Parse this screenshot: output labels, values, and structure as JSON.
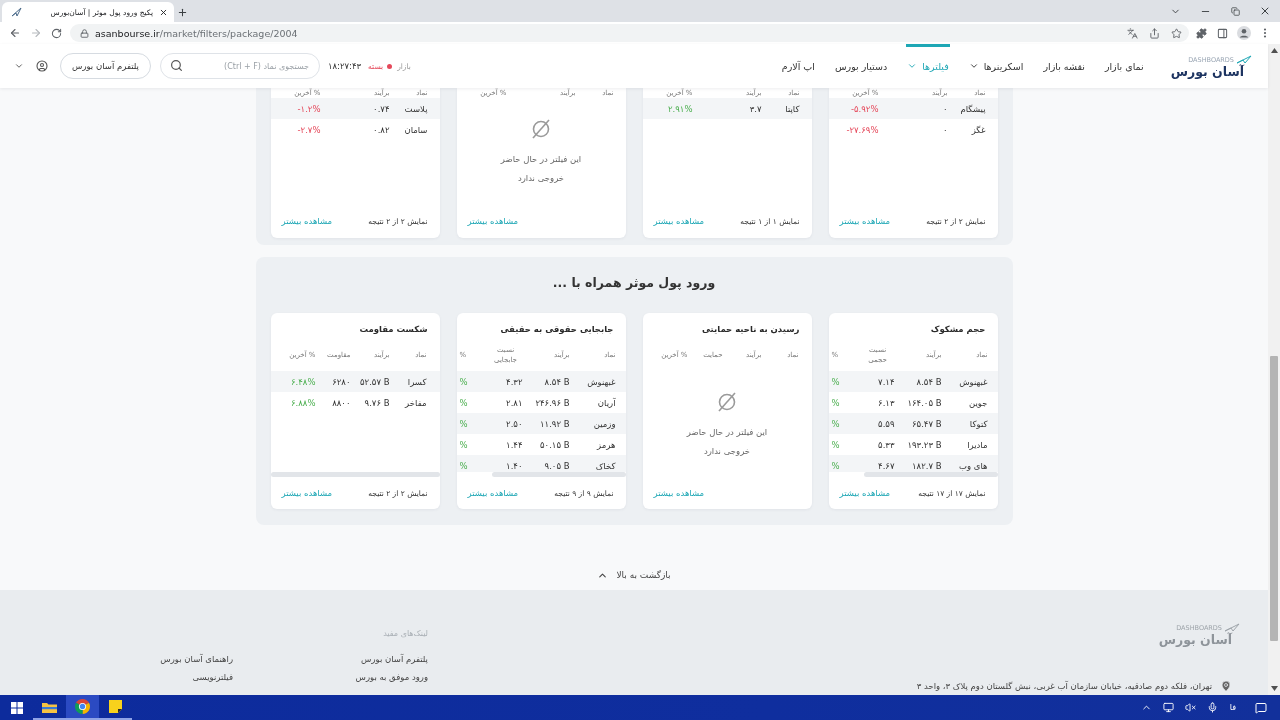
{
  "browser": {
    "tab_title": "پکیج ورود پول موثر | آسان‌بورس",
    "url_host": "asanbourse.ir",
    "url_path": "/market/filters/package/2004"
  },
  "header": {
    "logo": {
      "wordmark": "آسان بورس",
      "tagline": "DASHBOARDS"
    },
    "nav": [
      {
        "label": "نمای بازار",
        "selected": false,
        "has_menu": false
      },
      {
        "label": "نقشه بازار",
        "selected": false,
        "has_menu": false
      },
      {
        "label": "اسکرینرها",
        "selected": false,
        "has_menu": true
      },
      {
        "label": "فیلترها",
        "selected": true,
        "has_menu": true
      },
      {
        "label": "دستیار بورس",
        "selected": false,
        "has_menu": false
      },
      {
        "label": "اپ آلارم",
        "selected": false,
        "has_menu": false
      }
    ],
    "market": {
      "label": "بازار",
      "status": "بسته",
      "open": false,
      "time": "۱۸:۲۷:۴۳"
    },
    "search": {
      "placeholder": "جستجوی نماد (Ctrl + F)"
    },
    "platform_button": "پلتفرم آسان بورس"
  },
  "top_cards": [
    {
      "columns": [
        "نماد",
        "برآیند",
        "% آخرین"
      ],
      "rows": [
        {
          "cells": [
            "پیشگام",
            "۰"
          ],
          "change": "-۵.۹۲%",
          "positive": false
        },
        {
          "cells": [
            "غگز",
            "۰"
          ],
          "change": "-۲۷.۶۹%",
          "positive": false
        }
      ],
      "count": "نمایش ۲ از ۲ نتیجه",
      "more": "مشاهده بیشتر"
    },
    {
      "columns": [
        "نماد",
        "برآیند",
        "% آخرین"
      ],
      "rows": [
        {
          "cells": [
            "کاپتا",
            "۳.۷"
          ],
          "change": "۲.۹۱%",
          "positive": true
        }
      ],
      "count": "نمایش ۱ از ۱ نتیجه",
      "more": "مشاهده بیشتر"
    },
    {
      "columns": [
        "نماد",
        "برآیند",
        "% آخرین"
      ],
      "empty": [
        "این فیلتر در حال حاضر",
        "خروجی ندارد"
      ],
      "more": "مشاهده بیشتر"
    },
    {
      "columns": [
        "نماد",
        "برآیند",
        "% آخرین"
      ],
      "rows": [
        {
          "cells": [
            "پلاست",
            "۰.۷۴"
          ],
          "change": "-۱.۲%",
          "positive": false
        },
        {
          "cells": [
            "سامان",
            "۰.۸۲"
          ],
          "change": "-۲.۷%",
          "positive": false
        }
      ],
      "count": "نمایش ۲ از ۲ نتیجه",
      "more": "مشاهده بیشتر"
    }
  ],
  "section": {
    "title": "ورود پول موثر همراه با ...",
    "cards": [
      {
        "title": "حجم مشکوک",
        "columns": [
          "نماد",
          "برآیند",
          "نسبت حجمی",
          "%"
        ],
        "last_column_cut": true,
        "horizontal_scrollbar": true,
        "rows": [
          {
            "cells": [
              "غبهنوش",
              "۸.۵۴ B",
              "۷.۱۴"
            ],
            "change": "%",
            "positive": true
          },
          {
            "cells": [
              "جوین",
              "۱۶۴.۰۵ B",
              "۶.۱۳"
            ],
            "change": "%",
            "positive": true
          },
          {
            "cells": [
              "کتوکا",
              "۶۵.۴۷ B",
              "۵.۵۹"
            ],
            "change": "%",
            "positive": true
          },
          {
            "cells": [
              "مادیرا",
              "۱۹۳.۲۳ B",
              "۵.۳۳"
            ],
            "change": "%",
            "positive": true
          },
          {
            "cells": [
              "های وب",
              "۱۸۲.۷ B",
              "۴.۶۷"
            ],
            "change": "%",
            "positive": true
          }
        ],
        "count": "نمایش ۱۷ از ۱۷ نتیجه",
        "more": "مشاهده بیشتر"
      },
      {
        "title": "رسیدن به ناحیه حمایتی",
        "columns": [
          "نماد",
          "برآیند",
          "حمایت",
          "% آخرین"
        ],
        "last_column_cut": false,
        "horizontal_scrollbar": false,
        "empty": [
          "این فیلتر در حال حاضر",
          "خروجی ندارد"
        ],
        "more": "مشاهده بیشتر"
      },
      {
        "title": "جابجایی حقوقی به حقیقی",
        "columns": [
          "نماد",
          "برآیند",
          "نسبت جابجایی",
          "%"
        ],
        "last_column_cut": true,
        "horizontal_scrollbar": true,
        "rows": [
          {
            "cells": [
              "غبهنوش",
              "۸.۵۴ B",
              "۴.۳۲"
            ],
            "change": "%",
            "positive": true
          },
          {
            "cells": [
              "آریان",
              "۲۴۶.۹۶ B",
              "۲.۸۱"
            ],
            "change": "%",
            "positive": true
          },
          {
            "cells": [
              "وزمین",
              "۱۱.۹۲ B",
              "۲.۵۰"
            ],
            "change": "%",
            "positive": true
          },
          {
            "cells": [
              "هرمز",
              "۵۰.۱۵ B",
              "۱.۴۴"
            ],
            "change": "%",
            "positive": true
          },
          {
            "cells": [
              "کخاک",
              "۹.۰۵ B",
              "۱.۴۰"
            ],
            "change": "%",
            "positive": true
          }
        ],
        "count": "نمایش ۹ از ۹ نتیجه",
        "more": "مشاهده بیشتر"
      },
      {
        "title": "شکست مقاومت",
        "columns": [
          "نماد",
          "برآیند",
          "مقاومت",
          "% آخرین"
        ],
        "last_column_cut": false,
        "horizontal_scrollbar": true,
        "rows": [
          {
            "cells": [
              "کسرا",
              "۵۲.۵۷ B",
              "۶۲۸۰"
            ],
            "change": "۶.۴۸%",
            "positive": true
          },
          {
            "cells": [
              "مفاخر",
              "۹.۷۶ B",
              "۸۸۰۰"
            ],
            "change": "۶.۸۸%",
            "positive": true
          }
        ],
        "count": "نمایش ۲ از ۲ نتیجه",
        "more": "مشاهده بیشتر"
      }
    ]
  },
  "back_to_top": "بازگشت به بالا",
  "footer": {
    "logo": {
      "wordmark": "آسان بورس",
      "tagline": "DASHBOARDS"
    },
    "address": "تهران، فلکه دوم صادقیه، خیابان سازمان آب غربی، نبش گلستان دوم پلاک ۳، واحد ۳",
    "links_title": "لینک‌های مفید",
    "link_columns": [
      [
        "پلتفرم آسان بورس",
        "ورود موفق به بورس"
      ],
      [
        "راهنمای آسان بورس",
        "فیلترنویسی"
      ]
    ]
  },
  "taskbar": {
    "apps": [
      {
        "kind": "explorer",
        "active": false
      },
      {
        "kind": "chrome",
        "active": true
      },
      {
        "kind": "notes",
        "active": false
      }
    ],
    "language": "فا"
  }
}
